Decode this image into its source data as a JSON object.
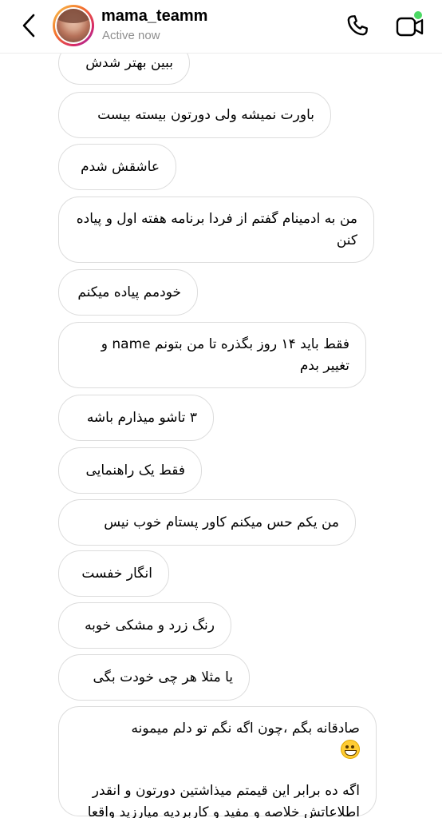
{
  "header": {
    "username": "mama_teamm",
    "status": "Active now",
    "back_icon": "chevron-left-icon",
    "call_icon": "phone-icon",
    "video_icon": "video-camera-icon",
    "online_color": "#4cd964"
  },
  "messages": [
    {
      "text": "ببین بهتر شدش"
    },
    {
      "text": "باورت نمیشه ولی دورتون بیسته بیست"
    },
    {
      "text": "عاشقش شدم"
    },
    {
      "text": "من به ادمینام گفتم از فردا برنامه هفته اول و پیاده کنن"
    },
    {
      "text": "خودمم پیاده میکنم"
    },
    {
      "text": "فقط باید ۱۴ روز بگذره تا من بتونم name و تغییر بدم"
    },
    {
      "text": "۳ تاشو میذارم باشه"
    },
    {
      "text": "فقط یک راهنمایی"
    },
    {
      "text": "من یکم حس میکنم کاور پستام خوب نیس"
    },
    {
      "text": "انگار خفست"
    },
    {
      "text": "رنگ زرد و مشکی خوبه"
    },
    {
      "text": "یا مثلا هر چی خودت بگی"
    },
    {
      "text": "صادقانه بگم ،چون اگه نگم تو دلم میمونه",
      "emoji": "grinning-face-emoji",
      "text_rest": "اگه ده برابر این قیمتم میذاشتین دورتون و انقدر اطلاعاتش خلاصه و مفید و کاربردیه میارزید واقعا میارزید"
    }
  ]
}
